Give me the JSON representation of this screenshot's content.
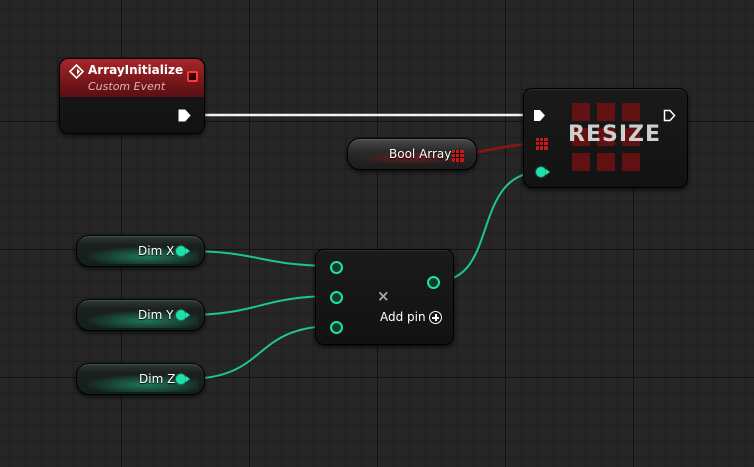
{
  "event_node": {
    "title": "ArrayInitialize",
    "subtitle": "Custom Event",
    "icon": "event-diamond-icon"
  },
  "bool_array_node": {
    "label": "Bool Array"
  },
  "resize_node": {
    "title": "RESIZE"
  },
  "dim_nodes": [
    {
      "label": "Dim X"
    },
    {
      "label": "Dim Y"
    },
    {
      "label": "Dim Z"
    }
  ],
  "add_node": {
    "operator_icon": "multiply-icon",
    "operator_symbol": "×",
    "add_pin_label": "Add pin"
  },
  "colors": {
    "exec": "#ffffff",
    "integer": "#1fe0a8",
    "boolean_array": "#c51a1a",
    "event_header": "#8a1a1e",
    "background": "#262626"
  }
}
